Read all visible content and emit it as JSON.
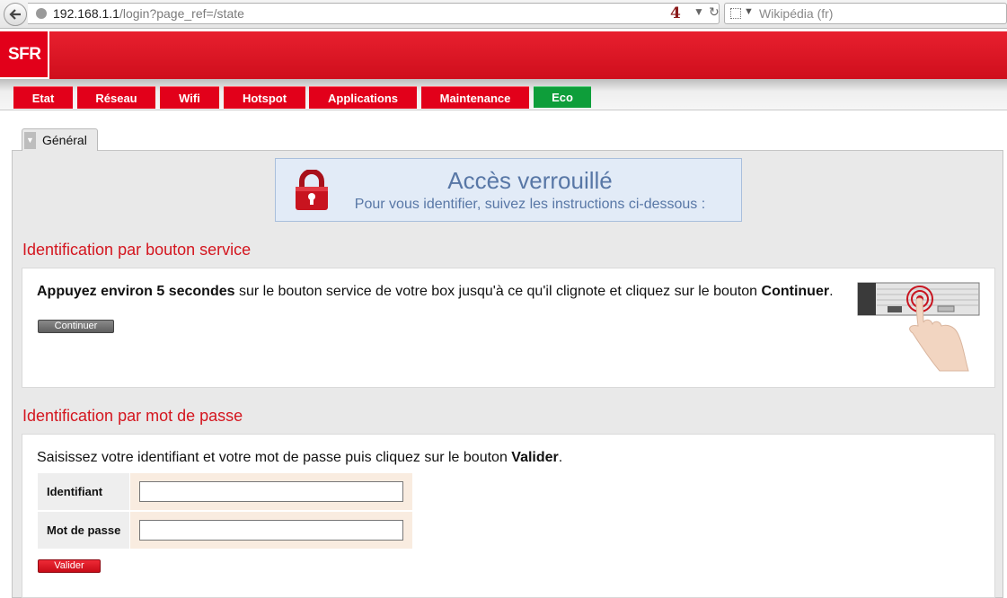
{
  "browser": {
    "url_host": "192.168.1.1",
    "url_path": "/login?page_ref=/state",
    "tab_count": "4",
    "search_placeholder": "Wikipédia (fr)"
  },
  "header": {
    "logo_text": "SFR"
  },
  "nav": {
    "tabs": [
      {
        "label": "Etat"
      },
      {
        "label": "Réseau"
      },
      {
        "label": "Wifi"
      },
      {
        "label": "Hotspot"
      },
      {
        "label": "Applications"
      },
      {
        "label": "Maintenance"
      },
      {
        "label": "Eco"
      }
    ]
  },
  "page": {
    "tab_label": "Général",
    "lock": {
      "title": "Accès verrouillé",
      "subtitle": "Pour vous identifier, suivez les instructions ci-dessous :"
    },
    "button_section": {
      "title": "Identification par bouton service",
      "instr_bold1": "Appuyez environ 5 secondes",
      "instr_text": " sur le bouton service de votre box jusqu'à ce qu'il clignote et cliquez sur le bouton ",
      "instr_bold2": "Continuer",
      "instr_end": ".",
      "button_label": "Continuer"
    },
    "password_section": {
      "title": "Identification par mot de passe",
      "instr_text": "Saisissez votre identifiant et votre mot de passe puis cliquez sur le bouton ",
      "instr_bold": "Valider",
      "instr_end": ".",
      "id_label": "Identifiant",
      "id_value": "",
      "pw_label": "Mot de passe",
      "pw_value": "",
      "button_label": "Valider"
    }
  }
}
